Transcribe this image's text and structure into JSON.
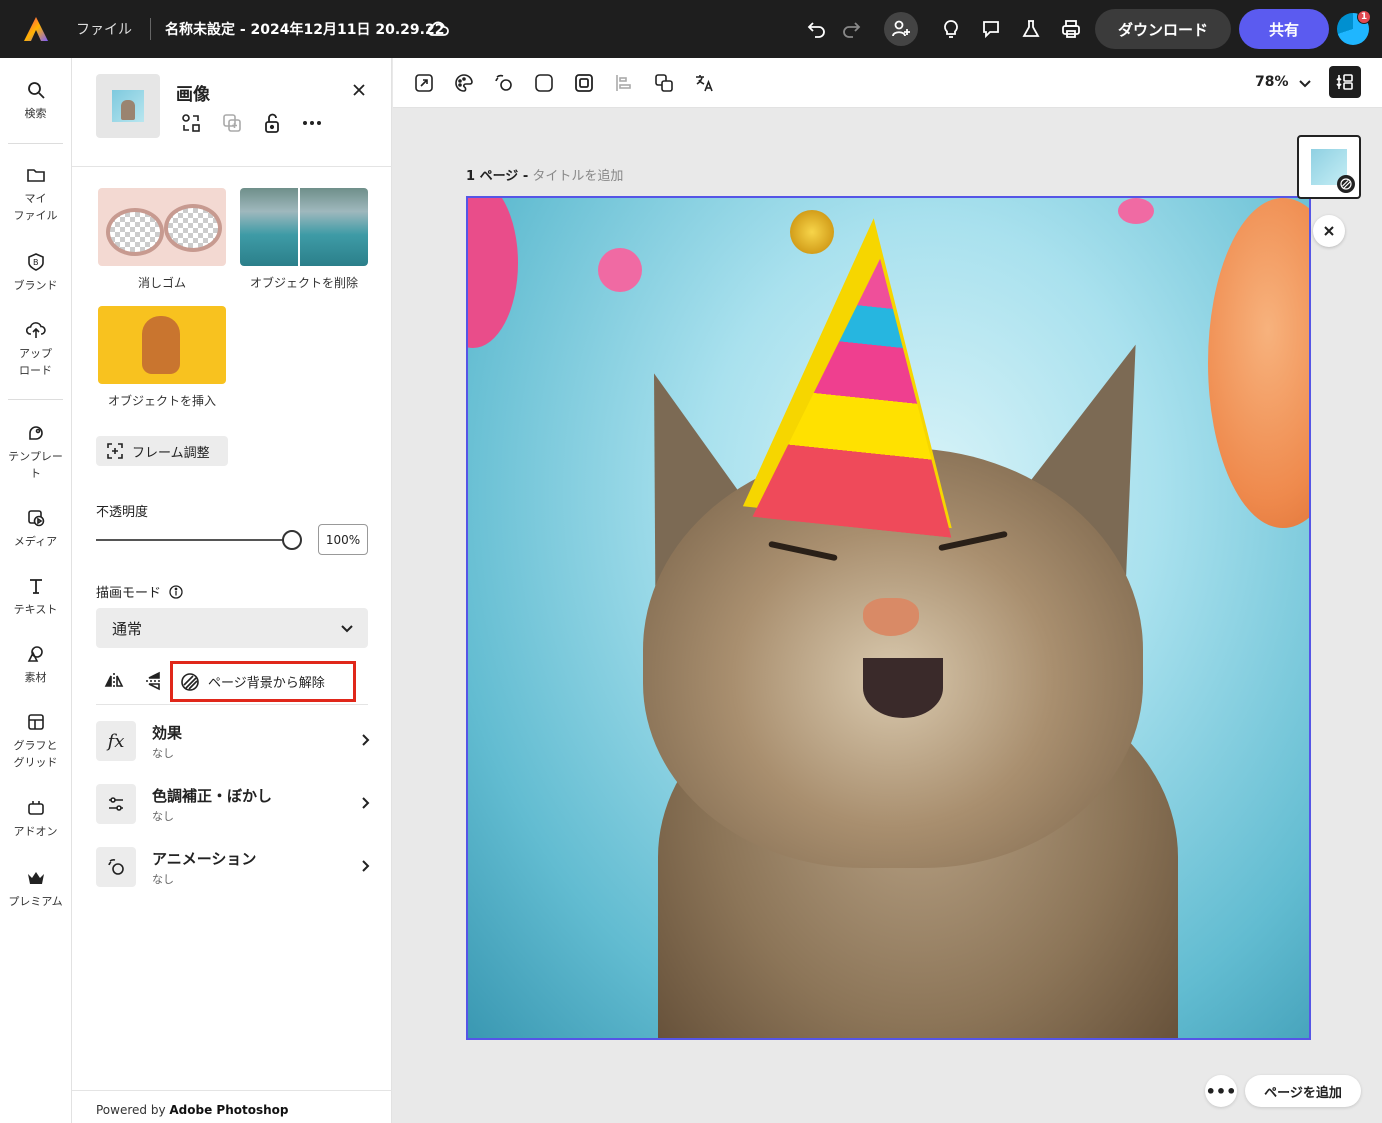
{
  "topbar": {
    "file_menu": "ファイル",
    "doc_title": "名称未設定 - 2024年12月11日 20.29.22",
    "download_label": "ダウンロード",
    "share_label": "共有",
    "notification_count": "1",
    "colors": {
      "bg": "#1e1e1e",
      "share": "#5b5bf0"
    }
  },
  "rail": {
    "items": [
      {
        "label": "検索",
        "icon": "search-icon"
      },
      {
        "label": "マイ\nファイル",
        "icon": "folder-icon"
      },
      {
        "label": "ブランド",
        "icon": "brand-icon"
      },
      {
        "label": "アップ\nロード",
        "icon": "upload-icon"
      },
      {
        "label": "テンプレー\nト",
        "icon": "template-icon"
      },
      {
        "label": "メディア",
        "icon": "media-icon"
      },
      {
        "label": "テキスト",
        "icon": "text-icon"
      },
      {
        "label": "素材",
        "icon": "elements-icon"
      },
      {
        "label": "グラフと\nグリッド",
        "icon": "grid-icon"
      },
      {
        "label": "アドオン",
        "icon": "addon-icon"
      },
      {
        "label": "プレミアム",
        "icon": "premium-icon"
      }
    ]
  },
  "panel": {
    "title": "画像",
    "tools": [
      {
        "label": "消しゴム"
      },
      {
        "label": "オブジェクトを削除"
      },
      {
        "label": "オブジェクトを挿入"
      }
    ],
    "frame_adjust": "フレーム調整",
    "opacity_label": "不透明度",
    "opacity_value": "100%",
    "opacity_fraction": 1.0,
    "blend_label": "描画モード",
    "blend_value": "通常",
    "detach_label": "ページ背景から解除",
    "accordions": [
      {
        "title": "効果",
        "sub": "なし"
      },
      {
        "title": "色調補正・ぼかし",
        "sub": "なし"
      },
      {
        "title": "アニメーション",
        "sub": "なし"
      }
    ],
    "powered_prefix": "Powered by",
    "powered_brand": "Adobe Photoshop",
    "colors": {
      "highlight": "#e0271a"
    }
  },
  "canvas": {
    "zoom": "78%",
    "page_label": "1 ページ -",
    "page_title_placeholder": "タイトルを追加",
    "add_page": "ページを追加",
    "more": "•••",
    "colors": {
      "selection": "#5555e6"
    }
  }
}
